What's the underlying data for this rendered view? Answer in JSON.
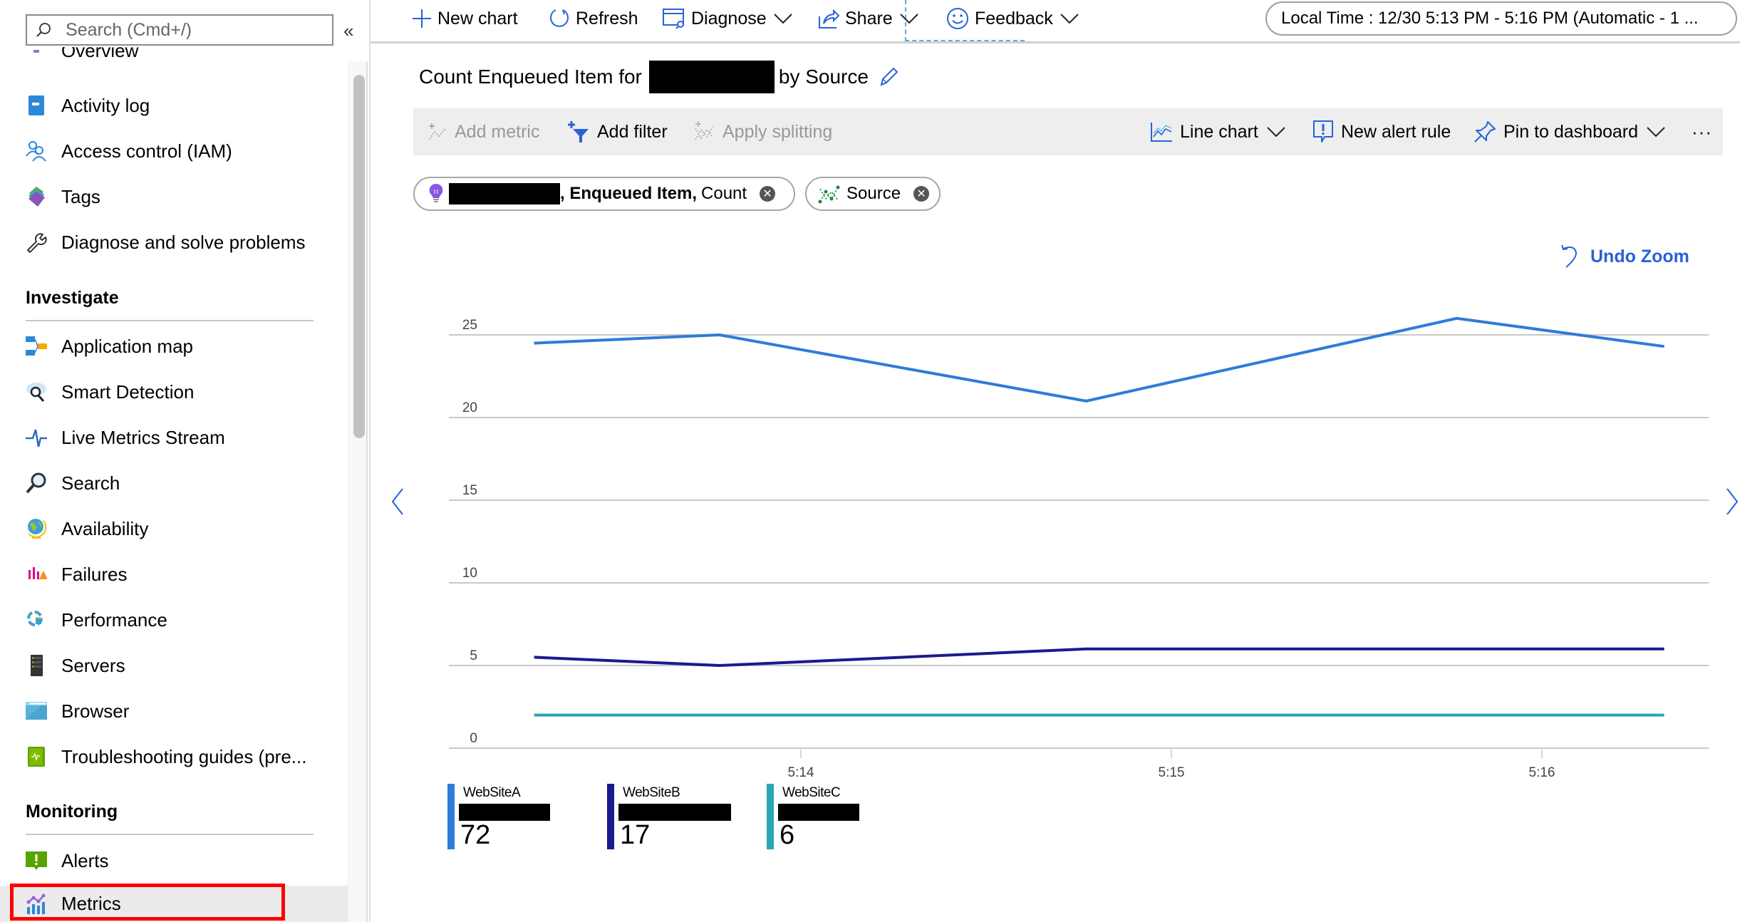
{
  "sidebar": {
    "search_placeholder": "Search (Cmd+/)",
    "collapse_label": "«",
    "items_top": [
      {
        "label": "Overview",
        "icon": "overview-icon"
      },
      {
        "label": "Activity log",
        "icon": "activity-log-icon"
      },
      {
        "label": "Access control (IAM)",
        "icon": "access-control-icon"
      },
      {
        "label": "Tags",
        "icon": "tags-icon"
      },
      {
        "label": "Diagnose and solve problems",
        "icon": "wrench-icon"
      }
    ],
    "sections": [
      {
        "title": "Investigate",
        "items": [
          {
            "label": "Application map",
            "icon": "application-map-icon"
          },
          {
            "label": "Smart Detection",
            "icon": "smart-detection-icon"
          },
          {
            "label": "Live Metrics Stream",
            "icon": "live-metrics-icon"
          },
          {
            "label": "Search",
            "icon": "search-icon"
          },
          {
            "label": "Availability",
            "icon": "availability-globe-icon"
          },
          {
            "label": "Failures",
            "icon": "failures-icon"
          },
          {
            "label": "Performance",
            "icon": "performance-icon"
          },
          {
            "label": "Servers",
            "icon": "servers-icon"
          },
          {
            "label": "Browser",
            "icon": "browser-icon"
          },
          {
            "label": "Troubleshooting guides (pre...",
            "icon": "troubleshooting-guides-icon"
          }
        ]
      },
      {
        "title": "Monitoring",
        "items": [
          {
            "label": "Alerts",
            "icon": "alerts-icon"
          },
          {
            "label": "Metrics",
            "icon": "metrics-icon",
            "active": true
          }
        ]
      }
    ]
  },
  "toolbar": {
    "new_chart": "New chart",
    "refresh": "Refresh",
    "diagnose": "Diagnose",
    "share": "Share",
    "feedback": "Feedback",
    "time_range": "Local Time : 12/30 5:13 PM - 5:16 PM (Automatic - 1 ..."
  },
  "chart_header": {
    "title_prefix": "Count Enqueued Item for",
    "title_suffix": "by Source",
    "title_redacted": true
  },
  "command_bar": {
    "add_metric": "Add metric",
    "add_filter": "Add filter",
    "apply_splitting": "Apply splitting",
    "line_chart": "Line chart",
    "new_alert_rule": "New alert rule",
    "pin_to_dashboard": "Pin to dashboard",
    "more": "···"
  },
  "pills": {
    "metric": {
      "resource_redacted": true,
      "metric_name": ", Enqueued Item,",
      "aggregation": "Count"
    },
    "split": {
      "label": "Source"
    }
  },
  "undo_zoom": "Undo Zoom",
  "colors": {
    "accent": "#2862d8",
    "websiteA": "#2f7bd8",
    "websiteB": "#1b1a8c",
    "websiteC": "#27a7b3"
  },
  "chart_data": {
    "type": "line",
    "title": "Count Enqueued Item by Source",
    "xlabel": "",
    "ylabel": "",
    "ylim": [
      0,
      25
    ],
    "yticks": [
      0,
      5,
      10,
      15,
      20,
      25
    ],
    "xticks": [
      "5:14",
      "5:15",
      "5:16"
    ],
    "xrange_minutes": [
      13.05,
      16.45
    ],
    "grid": true,
    "x": [
      "5:13:17",
      "5:13:47",
      "5:14:46",
      "5:15:46",
      "5:16:22"
    ],
    "x_minutes": [
      13.28,
      13.78,
      14.77,
      15.77,
      16.33
    ],
    "series": [
      {
        "name": "WebSiteA",
        "values": [
          24.5,
          25,
          21,
          26,
          24.3
        ],
        "total": "72"
      },
      {
        "name": "WebSiteB",
        "values": [
          5.5,
          5,
          6,
          6,
          6
        ],
        "total": "17"
      },
      {
        "name": "WebSiteC",
        "values": [
          2,
          2,
          2,
          2,
          2
        ],
        "total": "6"
      }
    ],
    "legend_placement": "bottom-left"
  }
}
